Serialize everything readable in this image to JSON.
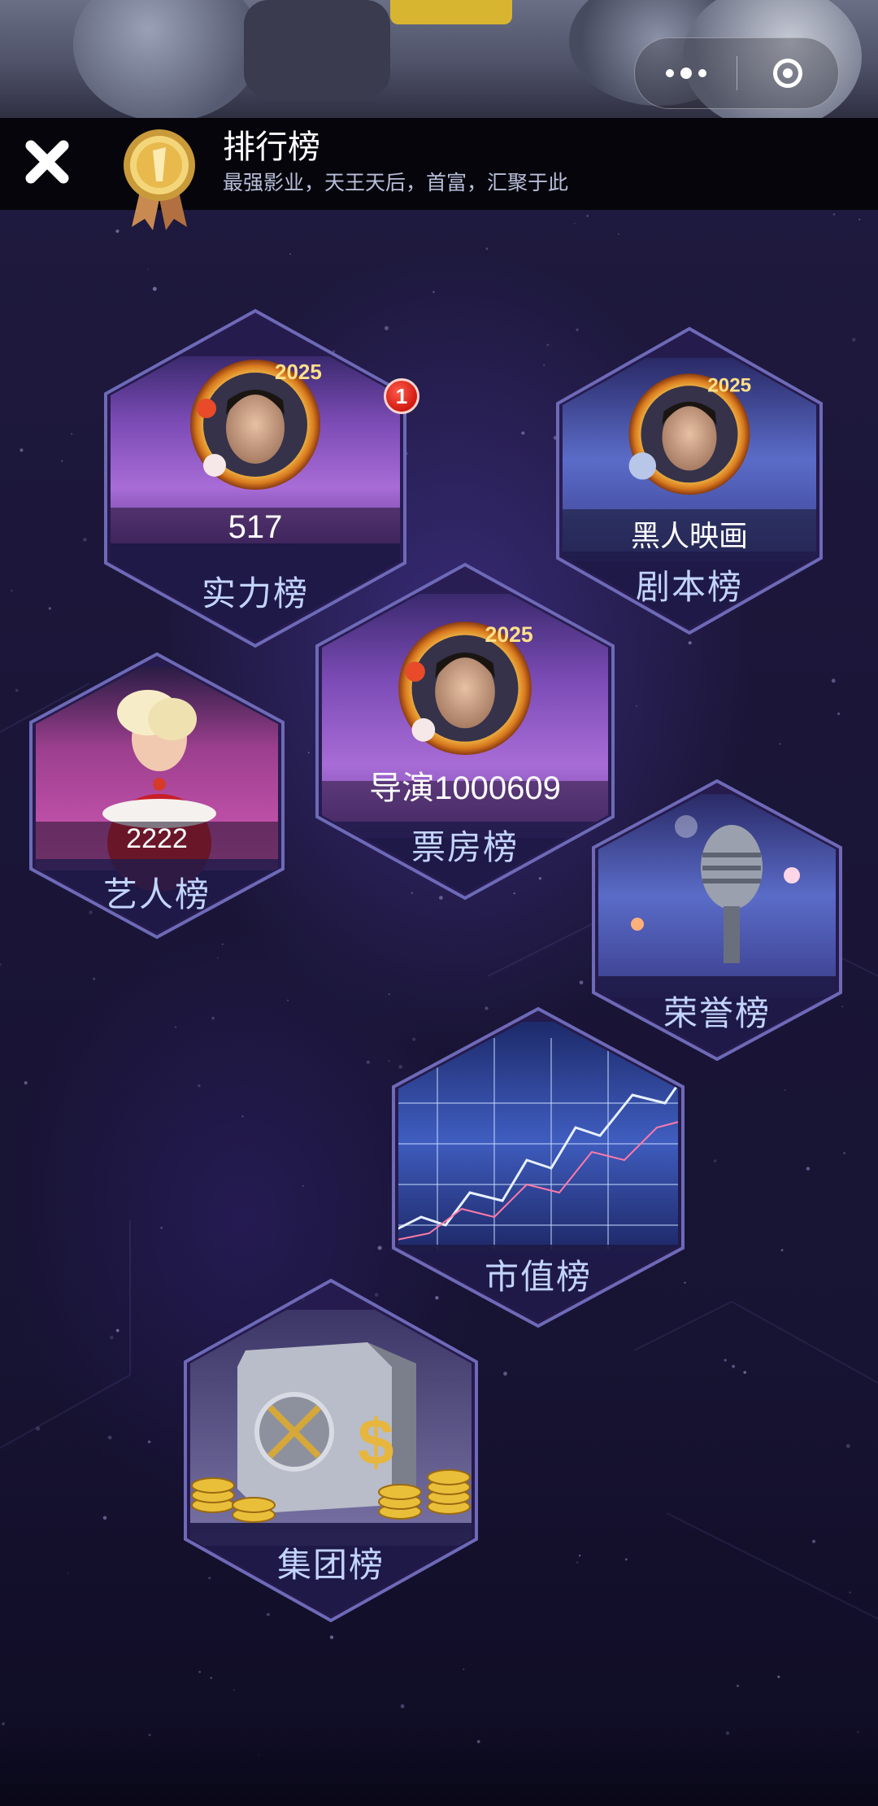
{
  "header": {
    "title": "排行榜",
    "subtitle": "最强影业，天王天后，首富，汇聚于此"
  },
  "tiles": {
    "strength": {
      "label": "实力榜",
      "value": "517",
      "badge": "1"
    },
    "script": {
      "label": "剧本榜",
      "value": "黑人映画"
    },
    "box_office": {
      "label": "票房榜",
      "value": "导演1000609"
    },
    "artist": {
      "label": "艺人榜",
      "value": "2222"
    },
    "honor": {
      "label": "荣誉榜"
    },
    "market_value": {
      "label": "市值榜"
    },
    "group": {
      "label": "集团榜"
    }
  },
  "avatar_frame": {
    "year": "2025"
  },
  "colors": {
    "background": "#1b1638",
    "header": "#05050b",
    "label": "#c3d4ff",
    "hex_border": "#6e6ab8",
    "badge": "#e0261c",
    "gold": "#f2c94c"
  }
}
